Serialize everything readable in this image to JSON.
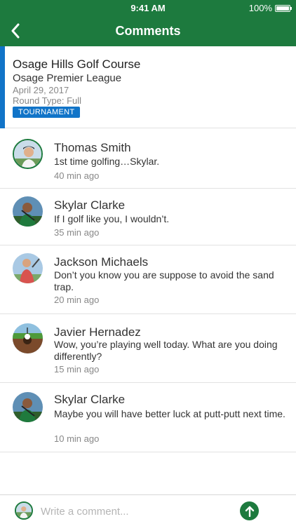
{
  "status_bar": {
    "time": "9:41 AM",
    "battery": "100%"
  },
  "nav": {
    "title": "Comments",
    "back_icon": "chevron-left-icon"
  },
  "event": {
    "course": "Osage Hills Golf Course",
    "league": "Osage Premier League",
    "date": "April 29, 2017",
    "round_type": "Round Type: Full",
    "badge": "TOURNAMENT"
  },
  "comments": [
    {
      "name": "Thomas Smith",
      "text": "1st time golfing…Skylar.",
      "time": "40 min ago"
    },
    {
      "name": "Skylar Clarke",
      "text": "If I golf like you, I wouldn’t.",
      "time": "35 min ago"
    },
    {
      "name": "Jackson Michaels",
      "text": "Don’t you know you are suppose to avoid the sand trap.",
      "time": "20 min ago"
    },
    {
      "name": "Javier Hernadez",
      "text": "Wow, you’re playing well today. What are you doing differently?",
      "time": "15 min ago"
    },
    {
      "name": "Skylar Clarke",
      "text": "Maybe you will have better luck at putt-putt next time.",
      "time": "10 min ago"
    }
  ],
  "composer": {
    "placeholder": "Write a comment..."
  },
  "colors": {
    "brand_green": "#1d7a3e",
    "accent_blue": "#1174c8"
  }
}
